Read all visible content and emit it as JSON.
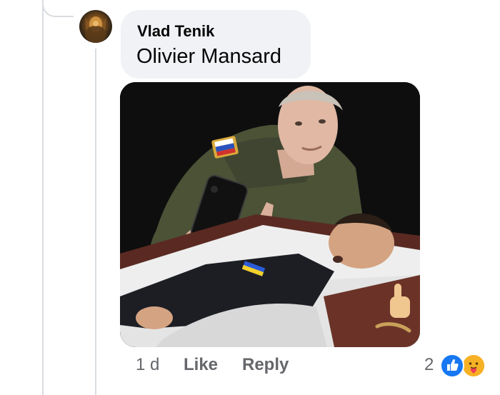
{
  "comment": {
    "author": "Vlad Tenik",
    "text": "Olivier Mansard",
    "timestamp": "1 d",
    "like_label": "Like",
    "reply_label": "Reply",
    "reaction_count": "2",
    "reactions": [
      "like-icon",
      "care-icon"
    ]
  },
  "colors": {
    "bubble_bg": "#f0f2f5",
    "meta_text": "#65676b",
    "like_blue": "#1877f2",
    "care_yellow": "#f7b125"
  }
}
